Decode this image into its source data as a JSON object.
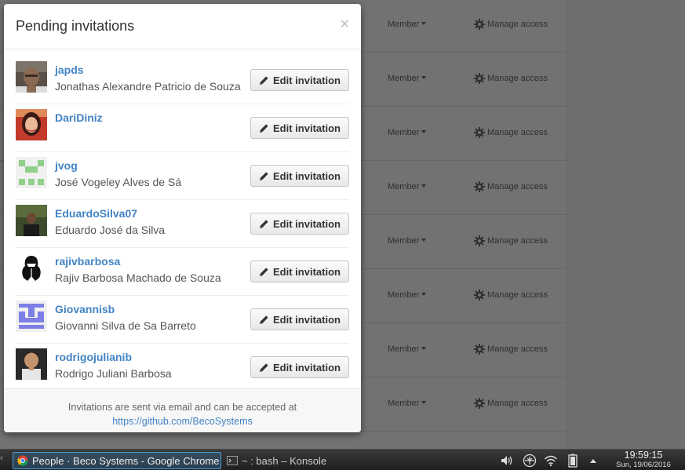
{
  "background": {
    "rows": [
      {
        "role_label": "Member",
        "manage_label": "Manage access"
      },
      {
        "role_label": "Member",
        "manage_label": "Manage access"
      },
      {
        "role_label": "Member",
        "manage_label": "Manage access"
      },
      {
        "role_label": "Member",
        "manage_label": "Manage access"
      },
      {
        "role_label": "Member",
        "manage_label": "Manage access"
      },
      {
        "role_label": "Member",
        "manage_label": "Manage access"
      },
      {
        "role_label": "Member",
        "manage_label": "Manage access"
      },
      {
        "role_label": "Member",
        "manage_label": "Manage access"
      }
    ]
  },
  "modal": {
    "title": "Pending invitations",
    "close_label": "×",
    "invitations": [
      {
        "username": "japds",
        "fullname": "Jonathas Alexandre Patricio de Souza",
        "button_label": "Edit invitation",
        "avatar": "photo-avatar"
      },
      {
        "username": "DariDiniz",
        "fullname": "",
        "button_label": "Edit invitation",
        "avatar": "photo-avatar"
      },
      {
        "username": "jvog",
        "fullname": "José Vogeley Alves de Sá",
        "button_label": "Edit invitation",
        "avatar": "identicon-avatar"
      },
      {
        "username": "EduardoSilva07",
        "fullname": "Eduardo José da Silva",
        "button_label": "Edit invitation",
        "avatar": "photo-avatar"
      },
      {
        "username": "rajivbarbosa",
        "fullname": "Rajiv Barbosa Machado de Souza",
        "button_label": "Edit invitation",
        "avatar": "dakar-logo-avatar"
      },
      {
        "username": "Giovannisb",
        "fullname": "Giovanni Silva de Sa Barreto",
        "button_label": "Edit invitation",
        "avatar": "identicon-avatar"
      },
      {
        "username": "rodrigojulianib",
        "fullname": "Rodrigo Juliani Barbosa",
        "button_label": "Edit invitation",
        "avatar": "photo-avatar"
      }
    ],
    "footer_text": "Invitations are sent via email and can be accepted at",
    "footer_link": "https://github.com/BecoSystems"
  },
  "taskbar": {
    "active_task": "People · Beco Systems - Google Chrome",
    "inactive_task": "~ : bash – Konsole",
    "time": "19:59:15",
    "date": "Sun, 19/06/2016"
  },
  "colors": {
    "link": "#4183c4",
    "identicon_green": "#8fd08a",
    "identicon_blue": "#7b7fe6"
  }
}
